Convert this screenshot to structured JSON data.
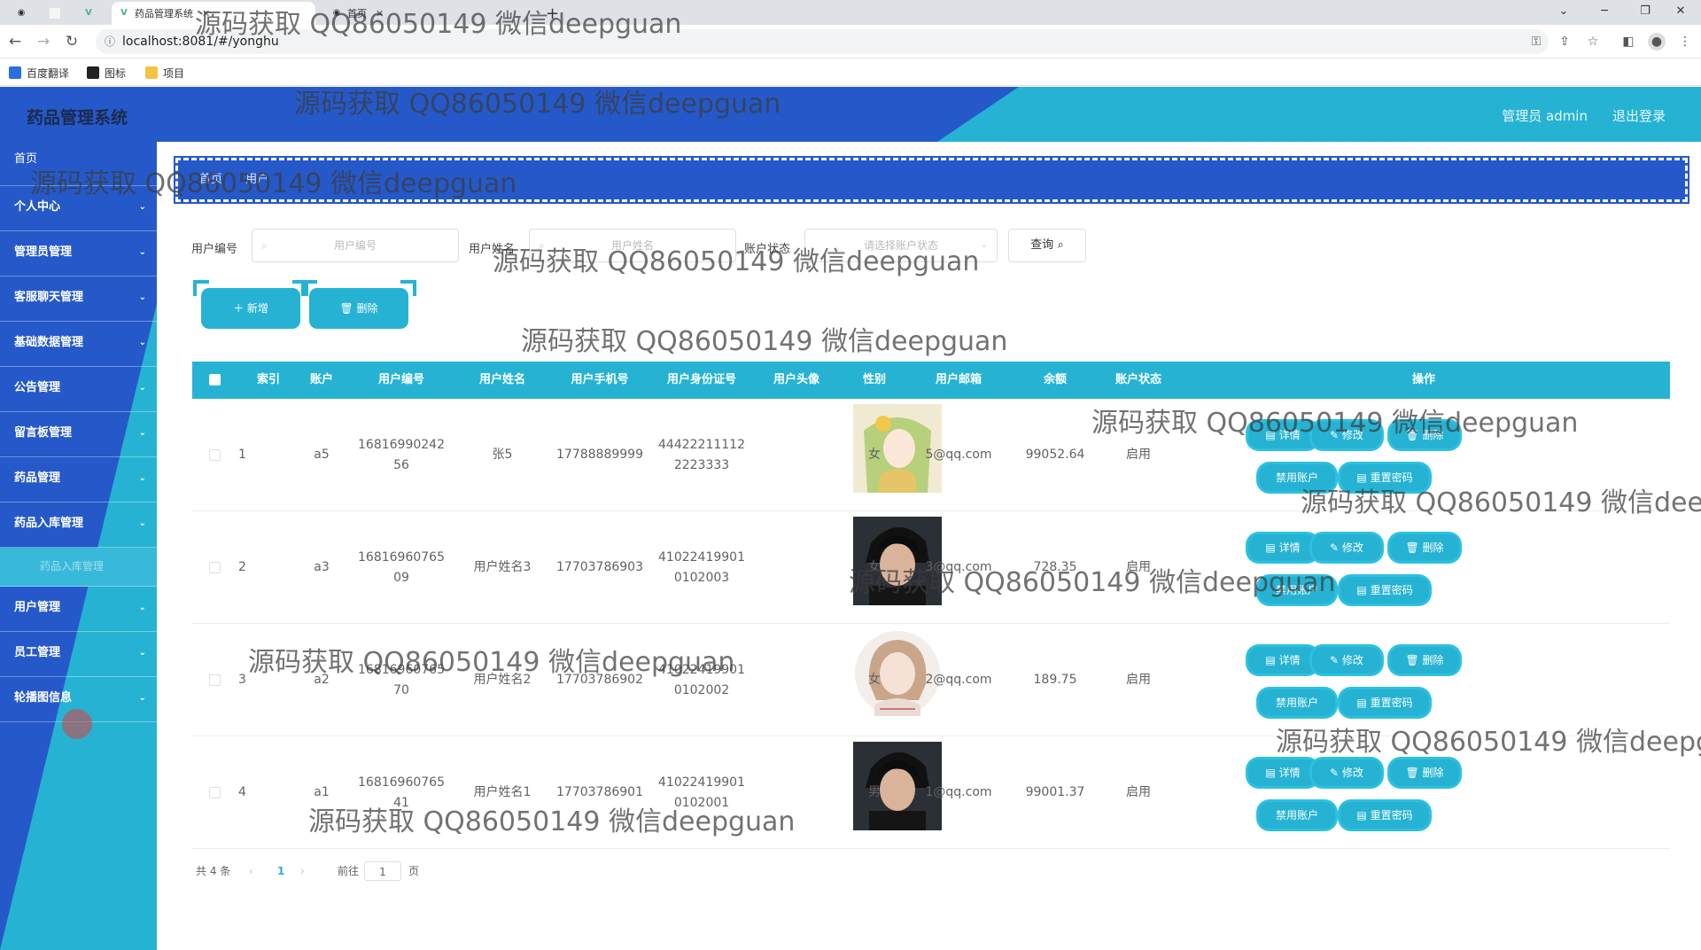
{
  "browser": {
    "tabs": [
      {
        "label": "",
        "icon": "github-icon"
      },
      {
        "label": "",
        "icon": "blank-tab-icon"
      },
      {
        "label": "",
        "icon": "vue-icon"
      },
      {
        "label": "药品管理系统",
        "icon": "vue-icon",
        "active": true
      },
      {
        "label": "首页",
        "icon": "github-icon"
      }
    ],
    "url": "localhost:8081/#/yonghu",
    "bookmarks": [
      "百度翻译",
      "图标",
      "项目"
    ]
  },
  "header": {
    "title": "药品管理系统",
    "user": "管理员 admin",
    "logout": "退出登录"
  },
  "sidebar": {
    "items": [
      {
        "label": "首页",
        "type": "home"
      },
      {
        "label": "个人中心"
      },
      {
        "label": "管理员管理"
      },
      {
        "label": "客服聊天管理"
      },
      {
        "label": "基础数据管理"
      },
      {
        "label": "公告管理"
      },
      {
        "label": "留言板管理"
      },
      {
        "label": "药品管理"
      },
      {
        "label": "药品入库管理"
      },
      {
        "label": "药品入库管理",
        "type": "sub"
      },
      {
        "label": "用户管理"
      },
      {
        "label": "员工管理"
      },
      {
        "label": "轮播图信息"
      }
    ]
  },
  "breadcrumb": [
    "首页",
    "用户"
  ],
  "search": {
    "fields": [
      {
        "label": "用户编号",
        "placeholder": "用户编号"
      },
      {
        "label": "用户姓名",
        "placeholder": "用户姓名"
      },
      {
        "label": "账户状态",
        "placeholder": "请选择账户状态"
      }
    ],
    "query_button": "查询"
  },
  "actions": {
    "add": "新增",
    "delete": "删除"
  },
  "table": {
    "headers": [
      "索引",
      "账户",
      "用户编号",
      "用户姓名",
      "用户手机号",
      "用户身份证号",
      "用户头像",
      "性别",
      "用户邮箱",
      "余额",
      "账户状态",
      "操作"
    ],
    "rows": [
      {
        "index": "1",
        "account": "a5",
        "code": "16816990242\n56",
        "name": "张5",
        "phone": "17788889999",
        "idcard": "44422211112\n2223333",
        "avatar": "avatar-girl-green",
        "gender": "女",
        "email": "5@qq.com",
        "balance": "99052.64",
        "status": "启用"
      },
      {
        "index": "2",
        "account": "a3",
        "code": "16816960765\n09",
        "name": "用户姓名3",
        "phone": "17703786903",
        "idcard": "41022419901\n0102003",
        "avatar": "avatar-boy",
        "gender": "女",
        "email": "3@qq.com",
        "balance": "728.35",
        "status": "启用"
      },
      {
        "index": "3",
        "account": "a2",
        "code": "16816960765\n70",
        "name": "用户姓名2",
        "phone": "17703786902",
        "idcard": "41022419901\n0102002",
        "avatar": "avatar-girl",
        "gender": "女",
        "email": "2@qq.com",
        "balance": "189.75",
        "status": "启用"
      },
      {
        "index": "4",
        "account": "a1",
        "code": "16816960765\n41",
        "name": "用户姓名1",
        "phone": "17703786901",
        "idcard": "41022419901\n0102001",
        "avatar": "avatar-boy",
        "gender": "男",
        "email": "1@qq.com",
        "balance": "99001.37",
        "status": "启用"
      }
    ],
    "ops": {
      "detail": "详情",
      "edit": "修改",
      "delete": "删除",
      "disable": "禁用账户",
      "reset": "重置密码"
    }
  },
  "pager": {
    "total": "共 4 条",
    "page": "1",
    "goto": "前往",
    "input": "1",
    "unit": "页"
  },
  "watermark": "源码获取 QQ86050149 微信deepguan",
  "colors": {
    "primary": "#26b3d3",
    "blue": "#2559c9"
  }
}
